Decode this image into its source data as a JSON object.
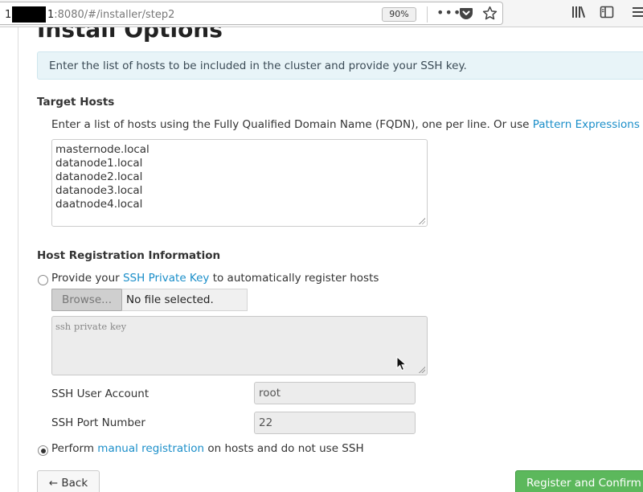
{
  "browser": {
    "url_prefix": "1",
    "url_host_suffix": "1",
    "url_path": ":8080/#/installer/step2",
    "zoom": "90%",
    "icons": [
      "page-actions-icon",
      "pocket-icon",
      "bookmark-star-icon",
      "library-icon",
      "sidebar-icon",
      "menu-icon"
    ]
  },
  "page": {
    "title": "Install Options",
    "info": "Enter the list of hosts to be included in the cluster and provide your SSH key."
  },
  "target_hosts": {
    "title": "Target Hosts",
    "desc_text": "Enter a list of hosts using the Fully Qualified Domain Name (FQDN), one per line. Or use ",
    "desc_link": "Pattern Expressions",
    "hosts": [
      "masternode.local",
      "datanode1.local",
      "datanode2.local",
      "datanode3.local",
      "daatnode4.local"
    ]
  },
  "registration": {
    "title": "Host Registration Information",
    "ssh_option": {
      "prefix": "Provide your ",
      "link": "SSH Private Key",
      "suffix": " to automatically register hosts",
      "selected": false
    },
    "browse_label": "Browse...",
    "file_status": "No file selected.",
    "key_placeholder": "ssh private key",
    "ssh_user_label": "SSH User Account",
    "ssh_user_value": "root",
    "ssh_port_label": "SSH Port Number",
    "ssh_port_value": "22",
    "manual_option": {
      "prefix": "Perform ",
      "link": "manual registration",
      "suffix": " on hosts and do not use SSH",
      "selected": true
    }
  },
  "actions": {
    "back_label": "← Back",
    "confirm_label": "Register and Confirm"
  },
  "colors": {
    "link": "#1a8ec9",
    "confirm": "#5cb85c",
    "info_bg": "#e8f4f8"
  }
}
